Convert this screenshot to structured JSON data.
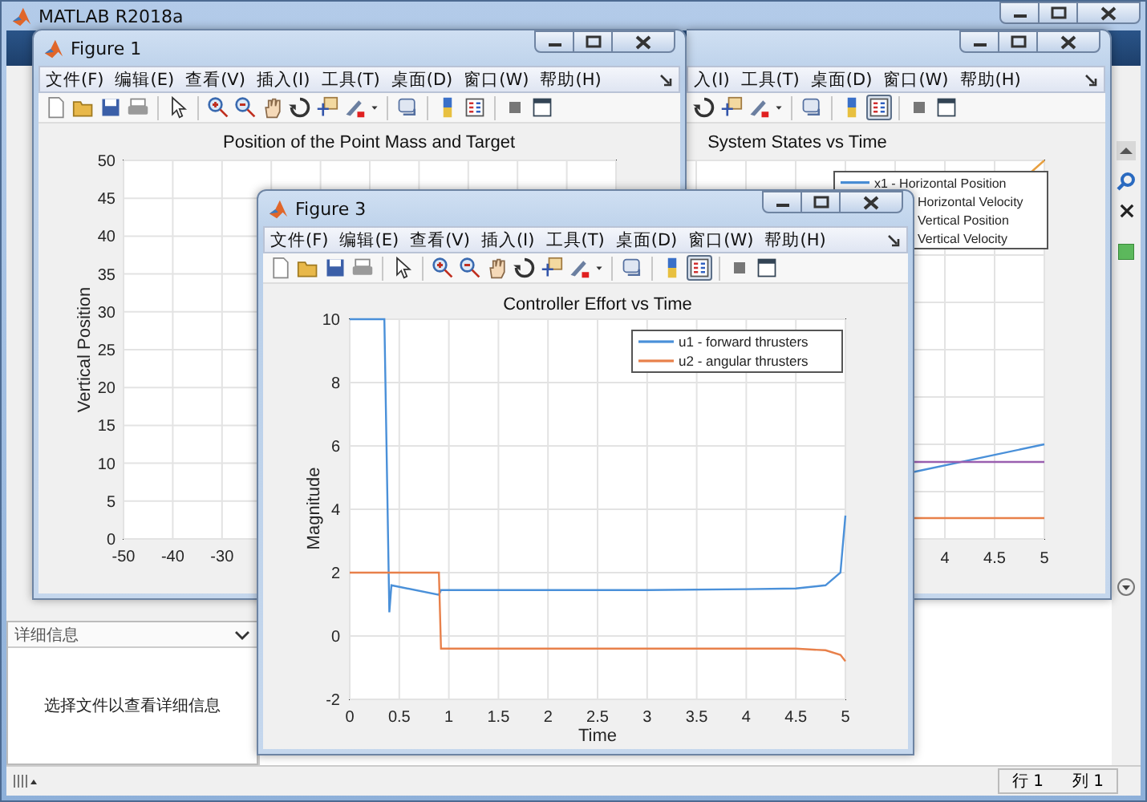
{
  "main_window": {
    "title": "MATLAB R2018a",
    "details_panel": {
      "header": "详细信息",
      "message": "选择文件以查看详细信息"
    },
    "status_bar": {
      "row": "行 1",
      "column": "列 1"
    }
  },
  "figure_1": {
    "title": "Figure 1",
    "menu": [
      "文件(F)",
      "编辑(E)",
      "查看(V)",
      "插入(I)",
      "工具(T)",
      "桌面(D)",
      "窗口(W)",
      "帮助(H)"
    ],
    "legend_button_pressed": false,
    "axes": {
      "title": "Position of the Point Mass and Target",
      "ylabel": "Vertical Position",
      "yticks": [
        "50",
        "45",
        "40",
        "35",
        "30",
        "25",
        "20",
        "15",
        "10",
        "5",
        "0"
      ],
      "xticks": [
        "-50",
        "-40",
        "-30"
      ]
    }
  },
  "figure_2": {
    "menu": [
      "入(I)",
      "工具(T)",
      "桌面(D)",
      "窗口(W)",
      "帮助(H)"
    ],
    "legend_button_pressed": true,
    "axes": {
      "title": "System States vs Time",
      "xticks": [
        "4",
        "4.5",
        "5"
      ],
      "legend": [
        {
          "label": "x1 - Horizontal Position",
          "color": "#4a90d9"
        },
        {
          "label": "Horizontal Velocity"
        },
        {
          "label": "Vertical Position"
        },
        {
          "label": "Vertical Velocity"
        }
      ]
    }
  },
  "figure_3": {
    "title": "Figure 3",
    "menu": [
      "文件(F)",
      "编辑(E)",
      "查看(V)",
      "插入(I)",
      "工具(T)",
      "桌面(D)",
      "窗口(W)",
      "帮助(H)"
    ],
    "legend_button_pressed": true,
    "chart_data": {
      "type": "line",
      "title": "Controller Effort vs Time",
      "xlabel": "Time",
      "ylabel": "Magnitude",
      "x": [
        0,
        0.35,
        0.4,
        0.42,
        0.9,
        0.92,
        1,
        2,
        3,
        4,
        4.5,
        4.8,
        4.95,
        5
      ],
      "series": [
        {
          "name": "u1 - forward thrusters",
          "color": "#4a90d9",
          "values": [
            10,
            10,
            0.75,
            1.6,
            1.3,
            1.45,
            1.45,
            1.45,
            1.45,
            1.48,
            1.5,
            1.6,
            2,
            3.8
          ]
        },
        {
          "name": "u2 - angular thrusters",
          "color": "#e8804a",
          "values": [
            2,
            2,
            2,
            2,
            2,
            -0.4,
            -0.4,
            -0.4,
            -0.4,
            -0.4,
            -0.4,
            -0.45,
            -0.6,
            -0.8
          ]
        }
      ],
      "grid": true,
      "legend": true,
      "xlim": [
        0,
        5
      ],
      "ylim": [
        -2,
        10
      ],
      "xticks": [
        0,
        0.5,
        1,
        1.5,
        2,
        2.5,
        3,
        3.5,
        4,
        4.5,
        5
      ],
      "yticks": [
        -2,
        0,
        2,
        4,
        6,
        8,
        10
      ]
    }
  }
}
